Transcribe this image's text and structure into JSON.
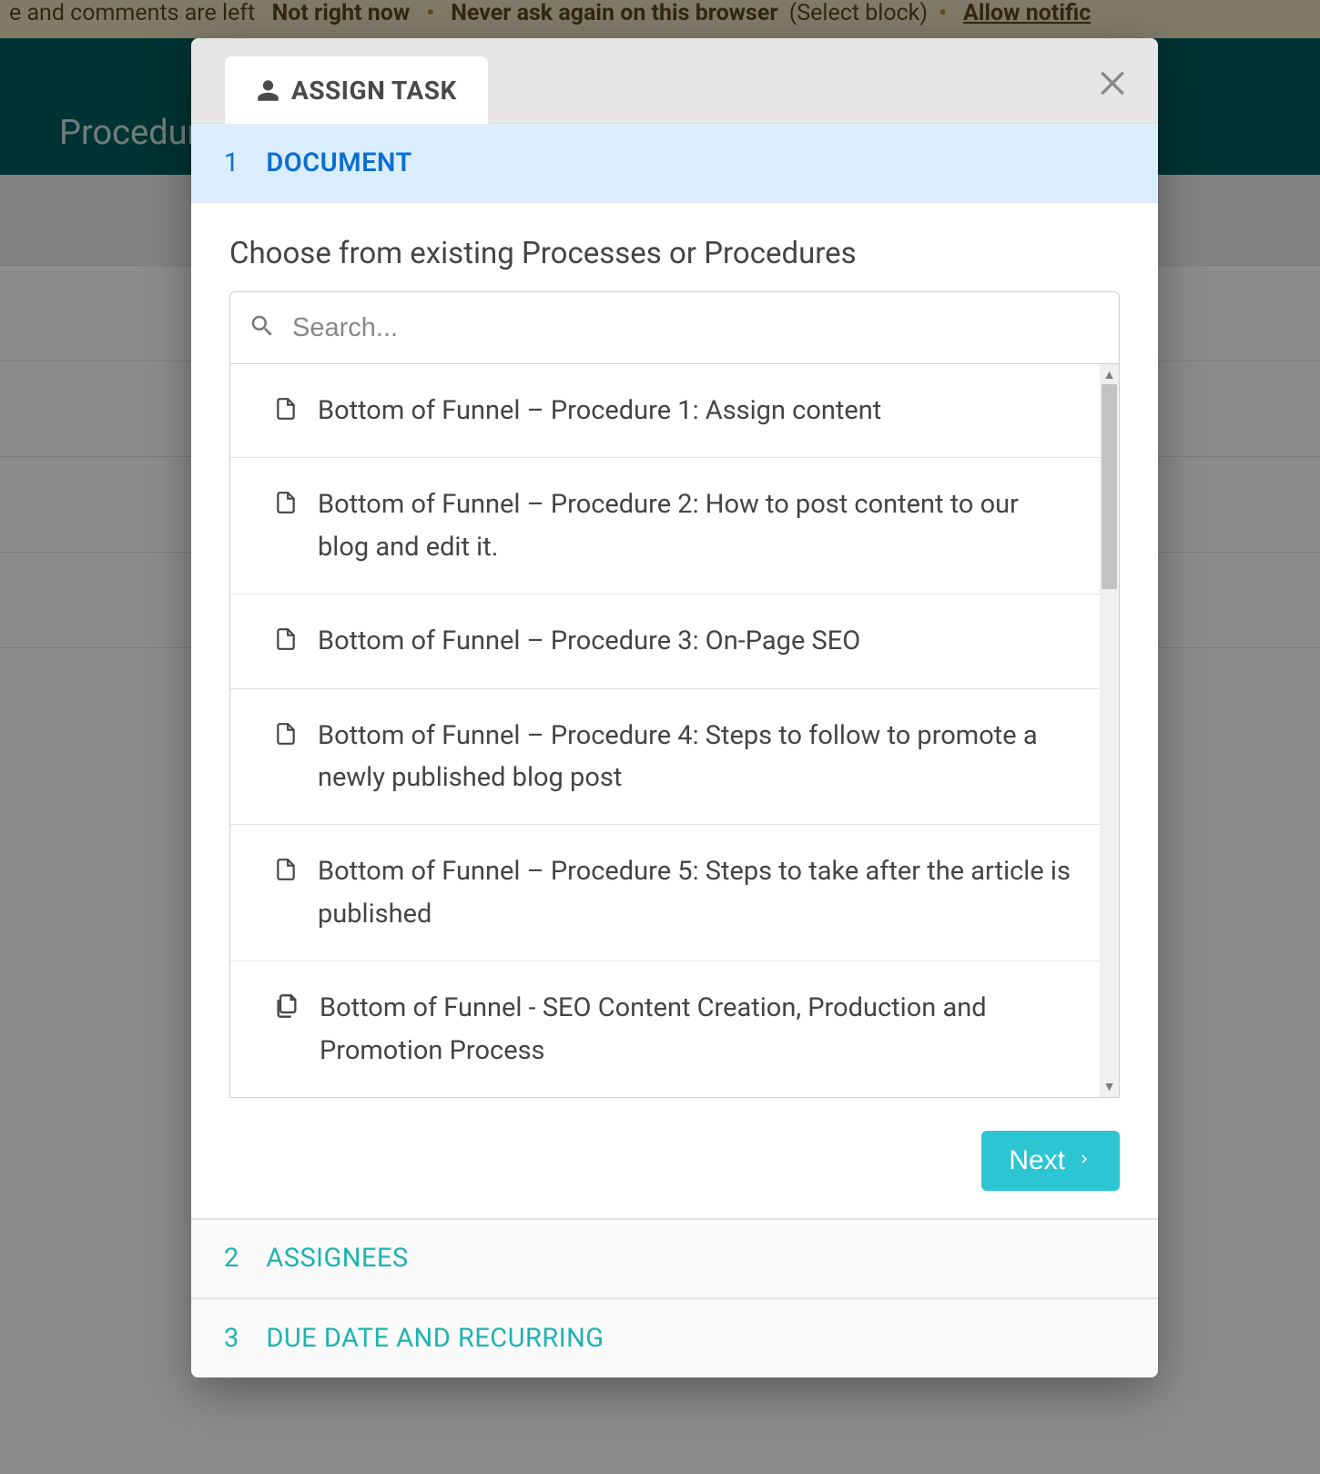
{
  "background": {
    "notification": {
      "fragment_pre": "e and comments are left",
      "not_now": "Not right now",
      "never": "Never ask again on this browser",
      "select_block": "(Select block)",
      "allow": "Allow notific"
    },
    "header_title": "Procedure"
  },
  "modal": {
    "tab_label": "ASSIGN TASK",
    "steps": {
      "step1": {
        "num": "1",
        "label": "DOCUMENT"
      },
      "step2": {
        "num": "2",
        "label": "ASSIGNEES"
      },
      "step3": {
        "num": "3",
        "label": "DUE DATE AND RECURRING"
      }
    },
    "choose_prompt": "Choose from existing Processes or Procedures",
    "search_placeholder": "Search...",
    "documents": [
      {
        "type": "doc",
        "title": "Bottom of Funnel – Procedure 1: Assign content"
      },
      {
        "type": "doc",
        "title": "Bottom of Funnel – Procedure 2: How to post content to our blog and edit it."
      },
      {
        "type": "doc",
        "title": "Bottom of Funnel – Procedure 3: On-Page SEO"
      },
      {
        "type": "doc",
        "title": "Bottom of Funnel – Procedure 4: Steps to follow to promote a newly published blog post"
      },
      {
        "type": "doc",
        "title": "Bottom of Funnel – Procedure 5: Steps to take after the article is published"
      },
      {
        "type": "process",
        "title": "Bottom of Funnel - SEO Content Creation, Production and Promotion Process"
      }
    ],
    "next_label": "Next"
  }
}
